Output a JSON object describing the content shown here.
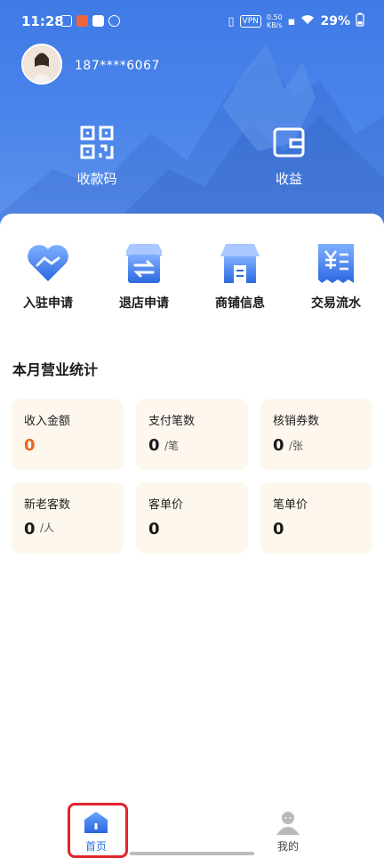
{
  "status_bar": {
    "time": "11:28",
    "vpn": "VPN",
    "net_speed_value": "0.50",
    "net_speed_unit": "KB/s",
    "battery": "29%"
  },
  "user": {
    "phone": "187****6067"
  },
  "top_actions": [
    {
      "label": "收款码",
      "icon": "qr-code-icon"
    },
    {
      "label": "收益",
      "icon": "wallet-icon"
    }
  ],
  "menu": [
    {
      "label": "入驻申请",
      "icon": "handshake-heart-icon"
    },
    {
      "label": "退店申请",
      "icon": "store-exchange-icon"
    },
    {
      "label": "商铺信息",
      "icon": "shop-icon"
    },
    {
      "label": "交易流水",
      "icon": "receipt-yuan-icon"
    }
  ],
  "stats_section": {
    "title": "本月营业统计",
    "items": [
      {
        "title": "收入金额",
        "value": "0",
        "unit": ""
      },
      {
        "title": "支付笔数",
        "value": "0",
        "unit": "/笔"
      },
      {
        "title": "核销券数",
        "value": "0",
        "unit": "/张"
      },
      {
        "title": "新老客数",
        "value": "0",
        "unit": "/人"
      },
      {
        "title": "客单价",
        "value": "0",
        "unit": ""
      },
      {
        "title": "笔单价",
        "value": "0",
        "unit": ""
      }
    ]
  },
  "tabbar": [
    {
      "label": "首页",
      "icon": "home-icon",
      "active": true
    },
    {
      "label": "我的",
      "icon": "user-icon",
      "active": false
    }
  ],
  "colors": {
    "header_blue": "#3f7ae6",
    "accent_blue": "#2f6fe4",
    "income_orange": "#e8661d",
    "stat_card_bg": "#fdf7ee",
    "highlight_red": "#e0252b"
  }
}
